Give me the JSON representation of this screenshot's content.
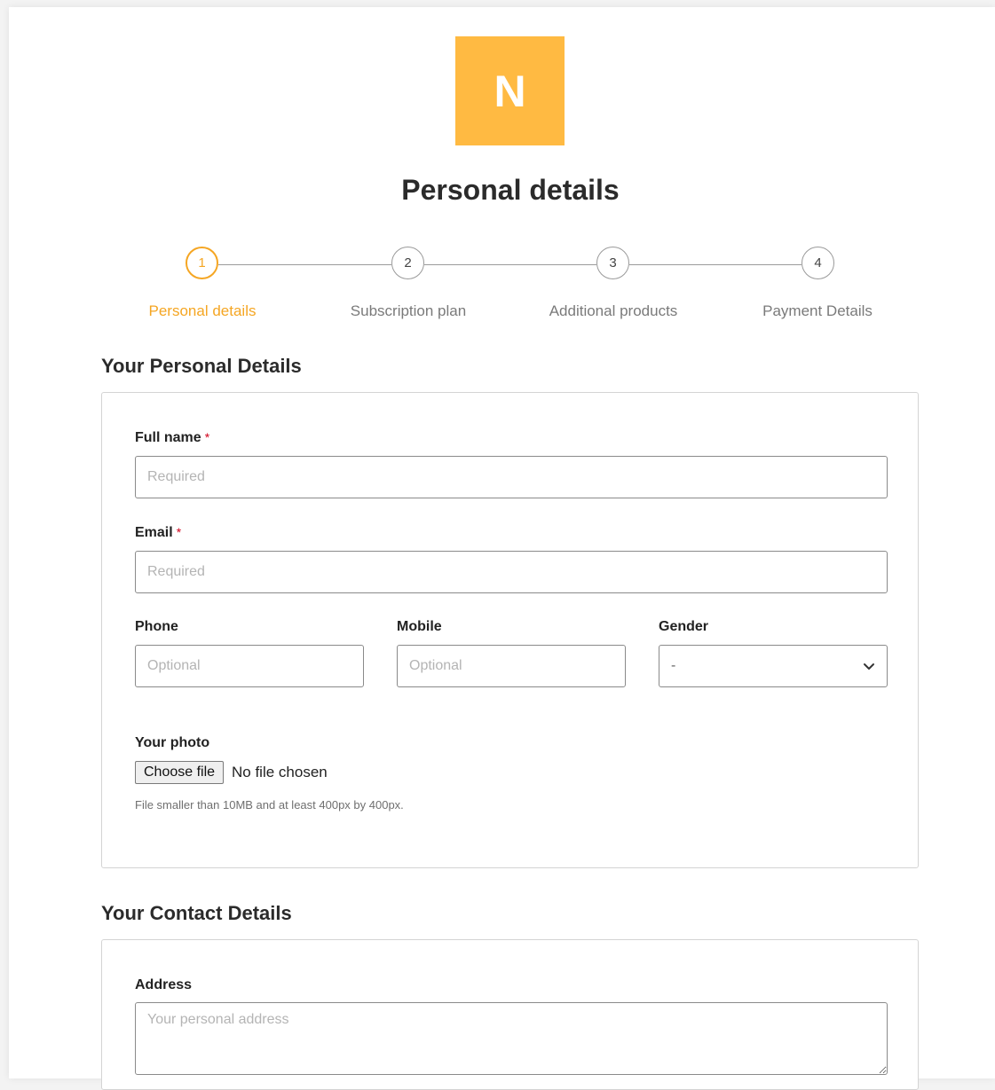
{
  "logo": {
    "letter": "N",
    "color": "#ffba42"
  },
  "page_title": "Personal details",
  "stepper": {
    "active_color": "#f5a623",
    "steps": [
      {
        "number": "1",
        "label": "Personal details",
        "active": true
      },
      {
        "number": "2",
        "label": "Subscription plan",
        "active": false
      },
      {
        "number": "3",
        "label": "Additional products",
        "active": false
      },
      {
        "number": "4",
        "label": "Payment Details",
        "active": false
      }
    ]
  },
  "personal_section": {
    "title": "Your Personal Details",
    "full_name": {
      "label": "Full name",
      "required_mark": "*",
      "placeholder": "Required",
      "value": ""
    },
    "email": {
      "label": "Email",
      "required_mark": "*",
      "placeholder": "Required",
      "value": ""
    },
    "phone": {
      "label": "Phone",
      "placeholder": "Optional",
      "value": ""
    },
    "mobile": {
      "label": "Mobile",
      "placeholder": "Optional",
      "value": ""
    },
    "gender": {
      "label": "Gender",
      "selected": "-"
    },
    "photo": {
      "label": "Your photo",
      "button_label": "Choose file",
      "status": "No file chosen",
      "hint": "File smaller than 10MB and at least 400px by 400px."
    }
  },
  "contact_section": {
    "title": "Your Contact Details",
    "address": {
      "label": "Address",
      "placeholder": "Your personal address",
      "value": ""
    }
  }
}
